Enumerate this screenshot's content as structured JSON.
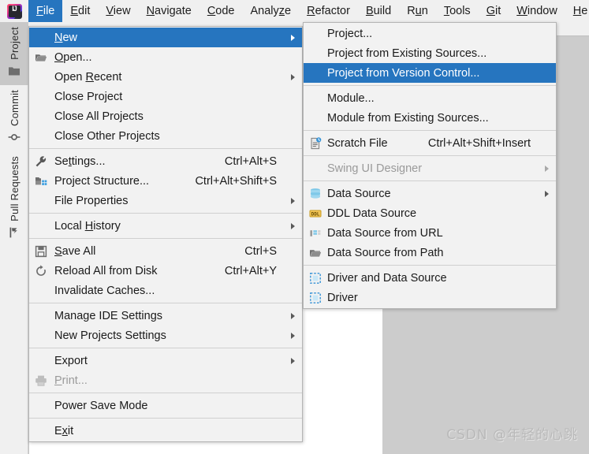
{
  "app": {
    "logo_icon": "intellij-idea-logo",
    "window_background": "#cccccc",
    "accent_color": "#2675bf",
    "menu_background": "#f2f2f2",
    "menu_text_color": "#1a1a1a",
    "disabled_text_color": "#9a9a9a"
  },
  "menubar": {
    "items": [
      {
        "label": "File",
        "mnemonic": "F",
        "active": true
      },
      {
        "label": "Edit",
        "mnemonic": "E",
        "active": false
      },
      {
        "label": "View",
        "mnemonic": "V",
        "active": false
      },
      {
        "label": "Navigate",
        "mnemonic": "N",
        "active": false
      },
      {
        "label": "Code",
        "mnemonic": "C",
        "active": false
      },
      {
        "label": "Analyze",
        "mnemonic": "z",
        "active": false
      },
      {
        "label": "Refactor",
        "mnemonic": "R",
        "active": false
      },
      {
        "label": "Build",
        "mnemonic": "B",
        "active": false
      },
      {
        "label": "Run",
        "mnemonic": "u",
        "active": false
      },
      {
        "label": "Tools",
        "mnemonic": "T",
        "active": false
      },
      {
        "label": "Git",
        "mnemonic": "G",
        "active": false
      },
      {
        "label": "Window",
        "mnemonic": "W",
        "active": false
      },
      {
        "label": "He",
        "mnemonic": "H",
        "active": false
      }
    ]
  },
  "left_tool_strip": {
    "tabs": [
      {
        "label": "Project",
        "icon": "folder-icon",
        "selected": true
      },
      {
        "label": "Commit",
        "icon": "commit-icon",
        "selected": false
      },
      {
        "label": "Pull Requests",
        "icon": "pull-request-icon",
        "selected": false
      }
    ]
  },
  "file_menu": {
    "title": "File",
    "items": [
      {
        "type": "item",
        "label": "New",
        "mnemonic": "N",
        "icon": null,
        "accel": "",
        "submenu": true,
        "highlighted": true,
        "disabled": false
      },
      {
        "type": "item",
        "label": "Open...",
        "mnemonic": "O",
        "icon": "open-folder-icon",
        "accel": "",
        "submenu": false,
        "highlighted": false,
        "disabled": false
      },
      {
        "type": "item",
        "label": "Open Recent",
        "mnemonic": "R",
        "icon": null,
        "accel": "",
        "submenu": true,
        "highlighted": false,
        "disabled": false
      },
      {
        "type": "item",
        "label": "Close Project",
        "mnemonic": "",
        "icon": null,
        "accel": "",
        "submenu": false,
        "highlighted": false,
        "disabled": false
      },
      {
        "type": "item",
        "label": "Close All Projects",
        "mnemonic": "",
        "icon": null,
        "accel": "",
        "submenu": false,
        "highlighted": false,
        "disabled": false
      },
      {
        "type": "item",
        "label": "Close Other Projects",
        "mnemonic": "",
        "icon": null,
        "accel": "",
        "submenu": false,
        "highlighted": false,
        "disabled": false
      },
      {
        "type": "separator"
      },
      {
        "type": "item",
        "label": "Settings...",
        "mnemonic": "t",
        "icon": "wrench-icon",
        "accel": "Ctrl+Alt+S",
        "submenu": false,
        "highlighted": false,
        "disabled": false
      },
      {
        "type": "item",
        "label": "Project Structure...",
        "mnemonic": "",
        "icon": "project-structure-icon",
        "accel": "Ctrl+Alt+Shift+S",
        "submenu": false,
        "highlighted": false,
        "disabled": false
      },
      {
        "type": "item",
        "label": "File Properties",
        "mnemonic": "",
        "icon": null,
        "accel": "",
        "submenu": true,
        "highlighted": false,
        "disabled": false
      },
      {
        "type": "separator"
      },
      {
        "type": "item",
        "label": "Local History",
        "mnemonic": "H",
        "icon": null,
        "accel": "",
        "submenu": true,
        "highlighted": false,
        "disabled": false
      },
      {
        "type": "separator"
      },
      {
        "type": "item",
        "label": "Save All",
        "mnemonic": "S",
        "icon": "save-icon",
        "accel": "Ctrl+S",
        "submenu": false,
        "highlighted": false,
        "disabled": false
      },
      {
        "type": "item",
        "label": "Reload All from Disk",
        "mnemonic": "",
        "icon": "reload-icon",
        "accel": "Ctrl+Alt+Y",
        "submenu": false,
        "highlighted": false,
        "disabled": false
      },
      {
        "type": "item",
        "label": "Invalidate Caches...",
        "mnemonic": "",
        "icon": null,
        "accel": "",
        "submenu": false,
        "highlighted": false,
        "disabled": false
      },
      {
        "type": "separator"
      },
      {
        "type": "item",
        "label": "Manage IDE Settings",
        "mnemonic": "",
        "icon": null,
        "accel": "",
        "submenu": true,
        "highlighted": false,
        "disabled": false
      },
      {
        "type": "item",
        "label": "New Projects Settings",
        "mnemonic": "",
        "icon": null,
        "accel": "",
        "submenu": true,
        "highlighted": false,
        "disabled": false
      },
      {
        "type": "separator"
      },
      {
        "type": "item",
        "label": "Export",
        "mnemonic": "",
        "icon": null,
        "accel": "",
        "submenu": true,
        "highlighted": false,
        "disabled": false
      },
      {
        "type": "item",
        "label": "Print...",
        "mnemonic": "P",
        "icon": "printer-icon",
        "accel": "",
        "submenu": false,
        "highlighted": false,
        "disabled": true
      },
      {
        "type": "separator"
      },
      {
        "type": "item",
        "label": "Power Save Mode",
        "mnemonic": "",
        "icon": null,
        "accel": "",
        "submenu": false,
        "highlighted": false,
        "disabled": false
      },
      {
        "type": "separator"
      },
      {
        "type": "item",
        "label": "Exit",
        "mnemonic": "x",
        "icon": null,
        "accel": "",
        "submenu": false,
        "highlighted": false,
        "disabled": false
      }
    ]
  },
  "new_submenu": {
    "title": "New",
    "items": [
      {
        "type": "item",
        "label": "Project...",
        "icon": null,
        "accel": "",
        "submenu": false,
        "highlighted": false,
        "disabled": false
      },
      {
        "type": "item",
        "label": "Project from Existing Sources...",
        "icon": null,
        "accel": "",
        "submenu": false,
        "highlighted": false,
        "disabled": false
      },
      {
        "type": "item",
        "label": "Project from Version Control...",
        "icon": null,
        "accel": "",
        "submenu": false,
        "highlighted": true,
        "disabled": false
      },
      {
        "type": "separator"
      },
      {
        "type": "item",
        "label": "Module...",
        "icon": null,
        "accel": "",
        "submenu": false,
        "highlighted": false,
        "disabled": false
      },
      {
        "type": "item",
        "label": "Module from Existing Sources...",
        "icon": null,
        "accel": "",
        "submenu": false,
        "highlighted": false,
        "disabled": false
      },
      {
        "type": "separator"
      },
      {
        "type": "item",
        "label": "Scratch File",
        "icon": "scratch-file-icon",
        "accel": "Ctrl+Alt+Shift+Insert",
        "submenu": false,
        "highlighted": false,
        "disabled": false
      },
      {
        "type": "separator"
      },
      {
        "type": "item",
        "label": "Swing UI Designer",
        "icon": null,
        "accel": "",
        "submenu": true,
        "highlighted": false,
        "disabled": true
      },
      {
        "type": "separator"
      },
      {
        "type": "item",
        "label": "Data Source",
        "icon": "database-icon",
        "accel": "",
        "submenu": true,
        "highlighted": false,
        "disabled": false
      },
      {
        "type": "item",
        "label": "DDL Data Source",
        "icon": "ddl-icon",
        "accel": "",
        "submenu": false,
        "highlighted": false,
        "disabled": false
      },
      {
        "type": "item",
        "label": "Data Source from URL",
        "icon": "url-source-icon",
        "accel": "",
        "submenu": false,
        "highlighted": false,
        "disabled": false
      },
      {
        "type": "item",
        "label": "Data Source from Path",
        "icon": "open-folder-icon",
        "accel": "",
        "submenu": false,
        "highlighted": false,
        "disabled": false
      },
      {
        "type": "separator"
      },
      {
        "type": "item",
        "label": "Driver and Data Source",
        "icon": "driver-icon",
        "accel": "",
        "submenu": false,
        "highlighted": false,
        "disabled": false
      },
      {
        "type": "item",
        "label": "Driver",
        "icon": "driver-icon",
        "accel": "",
        "submenu": false,
        "highlighted": false,
        "disabled": false
      }
    ]
  },
  "watermark": {
    "text": "CSDN @年轻的心跳"
  }
}
